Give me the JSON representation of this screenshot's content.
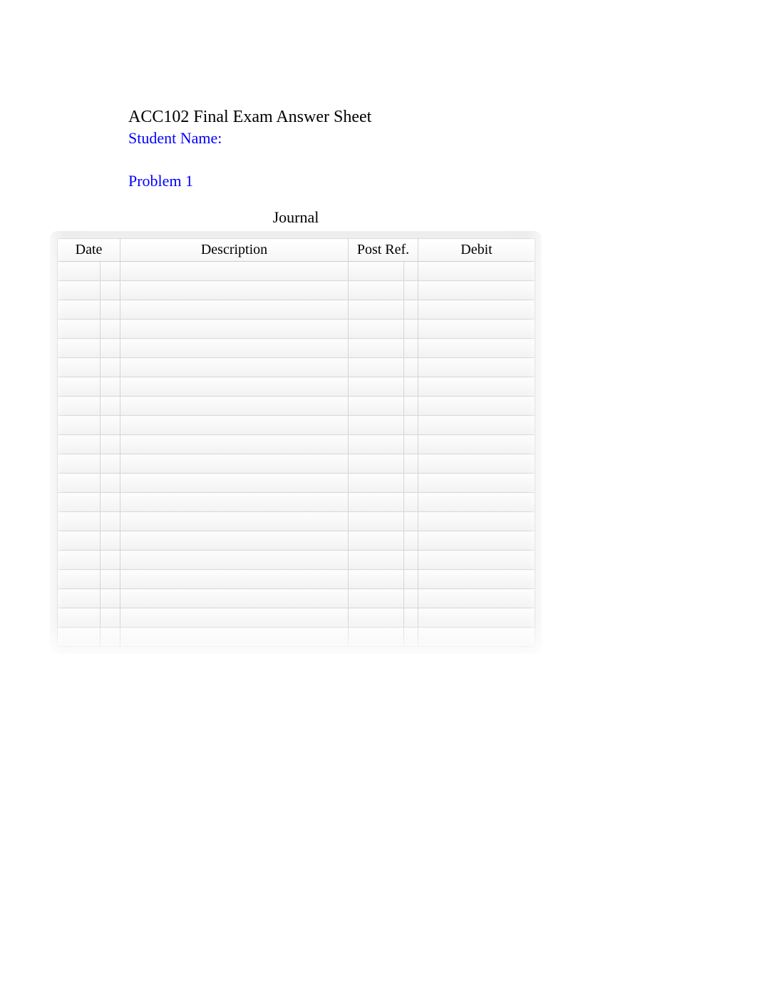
{
  "title": "ACC102 Final Exam Answer Sheet",
  "student_name_label": "Student Name:",
  "problem_label": "Problem 1",
  "journal_label": "Journal",
  "table": {
    "headers": {
      "date": "Date",
      "description": "Description",
      "post_ref": "Post Ref.",
      "debit": "Debit"
    },
    "rows": [
      {
        "date": "",
        "sub": "",
        "description": "",
        "post_ref": "",
        "debit": ""
      },
      {
        "date": "",
        "sub": "",
        "description": "",
        "post_ref": "",
        "debit": ""
      },
      {
        "date": "",
        "sub": "",
        "description": "",
        "post_ref": "",
        "debit": ""
      },
      {
        "date": "",
        "sub": "",
        "description": "",
        "post_ref": "",
        "debit": ""
      },
      {
        "date": "",
        "sub": "",
        "description": "",
        "post_ref": "",
        "debit": ""
      },
      {
        "date": "",
        "sub": "",
        "description": "",
        "post_ref": "",
        "debit": ""
      },
      {
        "date": "",
        "sub": "",
        "description": "",
        "post_ref": "",
        "debit": ""
      },
      {
        "date": "",
        "sub": "",
        "description": "",
        "post_ref": "",
        "debit": ""
      },
      {
        "date": "",
        "sub": "",
        "description": "",
        "post_ref": "",
        "debit": ""
      },
      {
        "date": "",
        "sub": "",
        "description": "",
        "post_ref": "",
        "debit": ""
      },
      {
        "date": "",
        "sub": "",
        "description": "",
        "post_ref": "",
        "debit": ""
      },
      {
        "date": "",
        "sub": "",
        "description": "",
        "post_ref": "",
        "debit": ""
      },
      {
        "date": "",
        "sub": "",
        "description": "",
        "post_ref": "",
        "debit": ""
      },
      {
        "date": "",
        "sub": "",
        "description": "",
        "post_ref": "",
        "debit": ""
      },
      {
        "date": "",
        "sub": "",
        "description": "",
        "post_ref": "",
        "debit": ""
      },
      {
        "date": "",
        "sub": "",
        "description": "",
        "post_ref": "",
        "debit": ""
      },
      {
        "date": "",
        "sub": "",
        "description": "",
        "post_ref": "",
        "debit": ""
      },
      {
        "date": "",
        "sub": "",
        "description": "",
        "post_ref": "",
        "debit": ""
      },
      {
        "date": "",
        "sub": "",
        "description": "",
        "post_ref": "",
        "debit": ""
      },
      {
        "date": "",
        "sub": "",
        "description": "",
        "post_ref": "",
        "debit": ""
      }
    ]
  },
  "colors": {
    "blue": "#0000ff",
    "black": "#000000"
  }
}
